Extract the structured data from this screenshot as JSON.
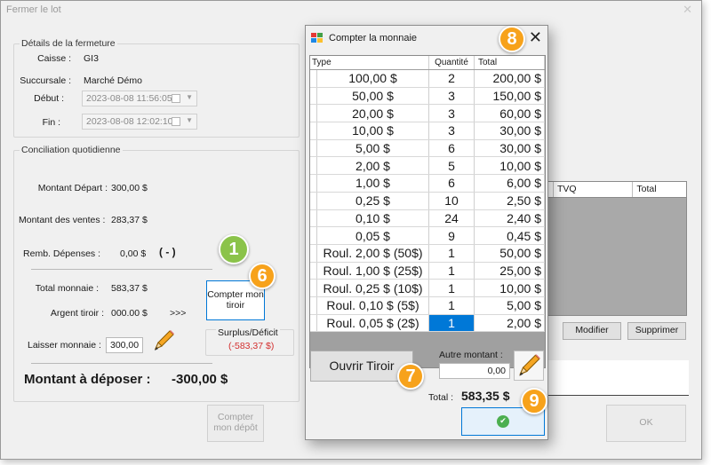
{
  "window": {
    "title": "Fermer le lot",
    "close_glyph": "✕"
  },
  "details": {
    "legend": "Détails de la fermeture",
    "caisse_label": "Caisse :",
    "caisse_value": "GI3",
    "succursale_label": "Succursale :",
    "succursale_value": "Marché Démo",
    "debut_label": "Début :",
    "debut_value": "2023-08-08 11:56:05",
    "fin_label": "Fin :",
    "fin_value": "2023-08-08 12:02:10"
  },
  "conciliation": {
    "legend": "Conciliation quotidienne",
    "montant_depart_label": "Montant Départ :",
    "montant_depart_value": "300,00 $",
    "montant_ventes_label": "Montant des ventes :",
    "montant_ventes_value": "283,37 $",
    "remb_label": "Remb. Dépenses :",
    "remb_value": "0,00 $",
    "remb_sign": "( - )",
    "total_monnaie_label": "Total monnaie :",
    "total_monnaie_value": "583,37 $",
    "argent_tiroir_label": "Argent tiroir :",
    "argent_tiroir_value": "000.00 $",
    "arrow_text": ">>>",
    "laisser_label": "Laisser monnaie :",
    "laisser_value": "300,00",
    "surplus_label": "Surplus/Déficit",
    "surplus_value": "(-583,37 $)",
    "deposer_label": "Montant à déposer :",
    "deposer_value": "-300,00 $",
    "compter_tiroir_label": "Compter mon tiroir",
    "compter_depot_label": "Compter mon dépôt"
  },
  "right_panel": {
    "columns": [
      "TVQ",
      "Total"
    ],
    "modifier_label": "Modifier",
    "supprimer_label": "Supprimer",
    "ok_label": "OK"
  },
  "badges": [
    "1",
    "6",
    "7",
    "8",
    "9"
  ],
  "dialog": {
    "title": "Compter la monnaie",
    "close_glyph": "✕",
    "columns": [
      "Type",
      "Quantité",
      "Total"
    ],
    "rows": [
      {
        "type": "100,00 $",
        "qty": "2",
        "total": "200,00 $"
      },
      {
        "type": "50,00 $",
        "qty": "3",
        "total": "150,00 $"
      },
      {
        "type": "20,00 $",
        "qty": "3",
        "total": "60,00 $"
      },
      {
        "type": "10,00 $",
        "qty": "3",
        "total": "30,00 $"
      },
      {
        "type": "5,00 $",
        "qty": "6",
        "total": "30,00 $"
      },
      {
        "type": "2,00 $",
        "qty": "5",
        "total": "10,00 $"
      },
      {
        "type": "1,00 $",
        "qty": "6",
        "total": "6,00 $"
      },
      {
        "type": "0,25 $",
        "qty": "10",
        "total": "2,50 $"
      },
      {
        "type": "0,10 $",
        "qty": "24",
        "total": "2,40 $"
      },
      {
        "type": "0,05 $",
        "qty": "9",
        "total": "0,45 $"
      },
      {
        "type": "Roul. 2,00 $ (50$)",
        "qty": "1",
        "total": "50,00 $"
      },
      {
        "type": "Roul. 1,00 $ (25$)",
        "qty": "1",
        "total": "25,00 $"
      },
      {
        "type": "Roul. 0,25 $ (10$)",
        "qty": "1",
        "total": "10,00 $"
      },
      {
        "type": "Roul. 0,10 $ (5$)",
        "qty": "1",
        "total": "5,00 $"
      },
      {
        "type": "Roul. 0,05 $ (2$)",
        "qty": "1",
        "total": "2,00 $"
      }
    ],
    "ouvrir_tiroir_label": "Ouvrir Tiroir",
    "autre_montant_label": "Autre montant :",
    "autre_montant_value": "0,00",
    "total_label": "Total :",
    "total_value": "583,35 $",
    "confirm_glyph": "✔"
  },
  "colors": {
    "badge_orange": "#f7a21b",
    "badge_green": "#8bc34a",
    "accent_blue": "#0078d7",
    "deficit_red": "#d32f2f"
  }
}
